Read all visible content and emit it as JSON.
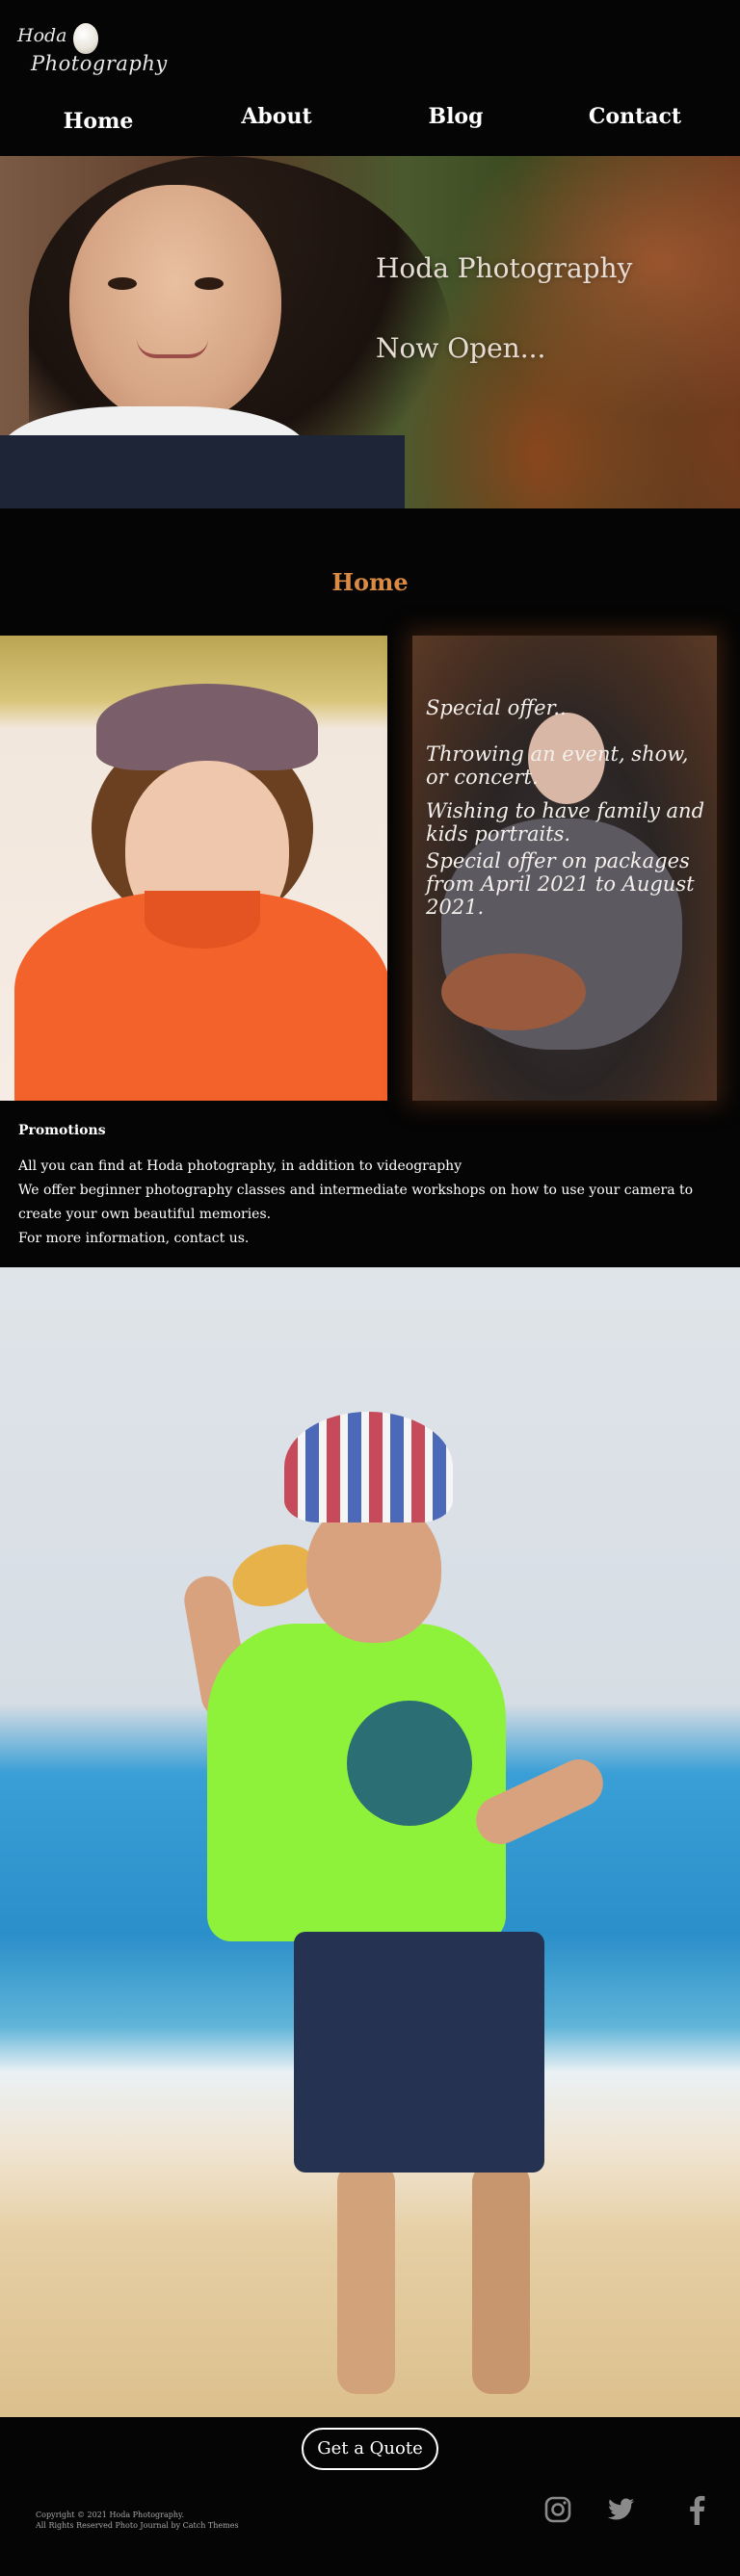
{
  "logo": {
    "line1": "Hoda",
    "line2": "Photography"
  },
  "nav": {
    "items": [
      {
        "label": "Home"
      },
      {
        "label": "About"
      },
      {
        "label": "Blog"
      },
      {
        "label": "Contact"
      }
    ]
  },
  "hero": {
    "title": "Hoda Photography",
    "subtitle": "Now Open..."
  },
  "section": {
    "heading": "Home"
  },
  "promo_card": {
    "line1": "Special offer..",
    "line2": "Throwing an event, show, or concert.",
    "line3": "Wishing to have family and kids portraits.",
    "line4": "Special offer on packages from April 2021 to August 2021."
  },
  "promotions": {
    "title": "Promotions",
    "line1": "All you can find at Hoda photography, in addition to videography",
    "line2": "We offer beginner photography classes and intermediate workshops on how to use your camera to create your own beautiful memories.",
    "line3": "For more information, contact us."
  },
  "footer": {
    "quote_label": "Get a Quote",
    "copyright1": "Copyright © 2021 Hoda Photography.",
    "copyright2": "All Rights Reserved Photo Journal by Catch Themes",
    "social_icons": [
      "instagram-icon",
      "twitter-icon",
      "facebook-icon"
    ]
  },
  "colors": {
    "accent": "#d98a45",
    "background": "#050505"
  }
}
